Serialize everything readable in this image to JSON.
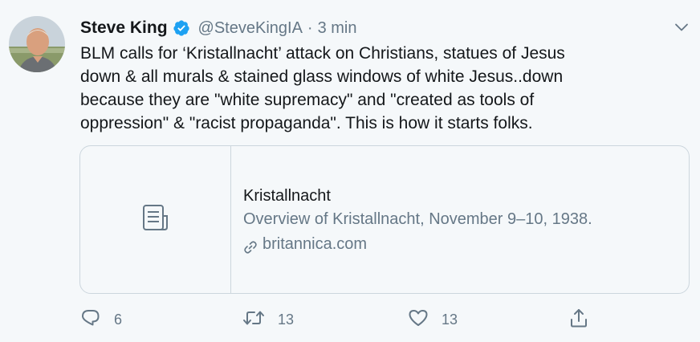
{
  "tweet": {
    "author": {
      "display_name": "Steve King",
      "handle": "@SteveKingIA",
      "verified": true
    },
    "separator": "·",
    "time": "3 min",
    "text_lines": [
      "BLM calls for ‘Kristallnacht’ attack on Christians, statues of Jesus",
      "down & all murals & stained glass windows of white Jesus..down",
      "because they are \"white supremacy\" and \"created as tools of",
      "oppression\" & \"racist propaganda\". This is how it starts folks."
    ],
    "card": {
      "title": "Kristallnacht",
      "description": "Overview of Kristallnacht, November 9–10, 1938.",
      "domain": "britannica.com"
    },
    "actions": {
      "reply_count": "6",
      "retweet_count": "13",
      "like_count": "13"
    }
  },
  "icons": {
    "verified": "verified-badge-icon",
    "menu": "chevron-down-icon",
    "card_thumb": "article-icon",
    "link": "link-icon",
    "reply": "reply-icon",
    "retweet": "retweet-icon",
    "like": "heart-icon",
    "share": "share-icon"
  },
  "colors": {
    "background": "#f5f8fa",
    "text_primary": "#14171a",
    "text_secondary": "#657786",
    "verified_blue": "#1da1f2",
    "border": "#ccd6dd"
  }
}
